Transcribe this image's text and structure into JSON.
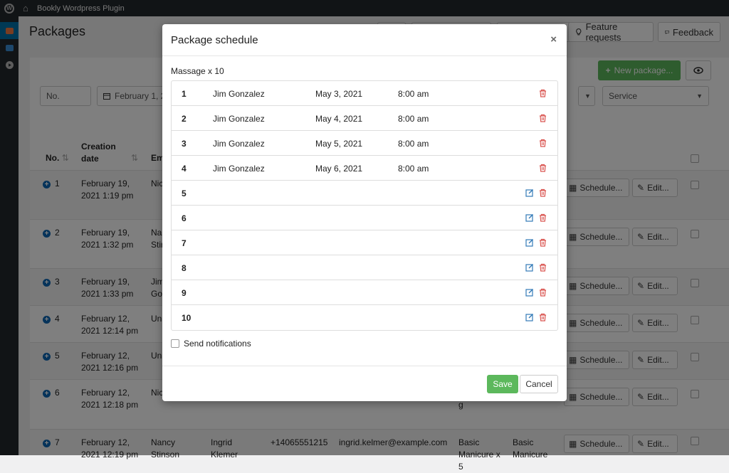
{
  "adminbar": {
    "site_title": "Bookly Wordpress Plugin"
  },
  "page": {
    "title": "Packages"
  },
  "toolbar": {
    "feature_requests": "Feature requests",
    "feedback": "Feedback"
  },
  "card": {
    "new_package": "New package...",
    "filter_no": "No.",
    "filter_date": "February 1, 20",
    "filter_service": "Service"
  },
  "table": {
    "headers": {
      "no": "No.",
      "creation_date": "Creation date",
      "email_partial": "Em"
    },
    "rows": [
      {
        "no": "1",
        "date1": "February 19,",
        "date2": "2021 1:19 pm",
        "cust1": "Nic",
        "cust2": ""
      },
      {
        "no": "2",
        "date1": "February 19,",
        "date2": "2021 1:32 pm",
        "cust1": "Nar",
        "cust2": "Stir"
      },
      {
        "no": "3",
        "date1": "February 19,",
        "date2": "2021 1:33 pm",
        "cust1": "Jim",
        "cust2": "Gor"
      },
      {
        "no": "4",
        "date1": "February 12,",
        "date2": "2021 12:14 pm",
        "cust1": "Una",
        "cust2": ""
      },
      {
        "no": "5",
        "date1": "February 12,",
        "date2": "2021 12:16 pm",
        "cust1": "Una",
        "cust2": ""
      },
      {
        "no": "6",
        "date1": "February 12,",
        "date2": "2021 12:18 pm",
        "cust1": "Nic",
        "cust2": ""
      },
      {
        "no": "7",
        "date1": "February 12,",
        "date2": "2021 12:19 pm",
        "cust1": "Nancy",
        "cust2": "Stinson"
      }
    ],
    "row7_extra": {
      "staff1": "Ingrid",
      "staff2": "Klemer",
      "phone": "+14065551215",
      "email": "ingrid.kelmer@example.com",
      "pkg1": "Basic",
      "pkg2": "Manicure x",
      "pkg3": "5",
      "svc1": "Basic",
      "svc2": "Manicure"
    },
    "row6_partial": "g",
    "schedule_label": "Schedule...",
    "edit_label": "Edit..."
  },
  "modal": {
    "title": "Package schedule",
    "close": "×",
    "subtitle": "Massage x 10",
    "rows": [
      {
        "num": "1",
        "name": "Jim Gonzalez",
        "date": "May 3, 2021",
        "time": "8:00 am"
      },
      {
        "num": "2",
        "name": "Jim Gonzalez",
        "date": "May 4, 2021",
        "time": "8:00 am"
      },
      {
        "num": "3",
        "name": "Jim Gonzalez",
        "date": "May 5, 2021",
        "time": "8:00 am"
      },
      {
        "num": "4",
        "name": "Jim Gonzalez",
        "date": "May 6, 2021",
        "time": "8:00 am"
      },
      {
        "num": "5",
        "name": "",
        "date": "",
        "time": ""
      },
      {
        "num": "6",
        "name": "",
        "date": "",
        "time": ""
      },
      {
        "num": "7",
        "name": "",
        "date": "",
        "time": ""
      },
      {
        "num": "8",
        "name": "",
        "date": "",
        "time": ""
      },
      {
        "num": "9",
        "name": "",
        "date": "",
        "time": ""
      },
      {
        "num": "10",
        "name": "",
        "date": "",
        "time": ""
      }
    ],
    "send_notifications": "Send notifications",
    "save": "Save",
    "cancel": "Cancel"
  },
  "colors": {
    "admin_bar": "#23282d",
    "accent_blue": "#0073aa",
    "success_green": "#5cb85c",
    "danger_red": "#d9534f",
    "edit_blue": "#337ab7"
  }
}
